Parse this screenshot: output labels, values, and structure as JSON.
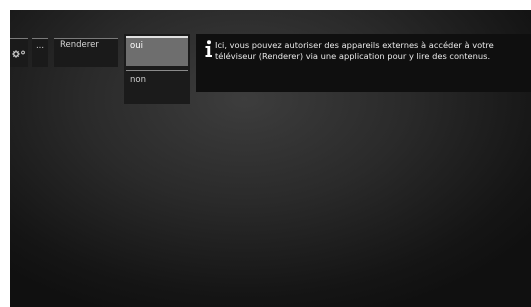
{
  "breadcrumb": {
    "settings_icon": "settings-gear-icon",
    "ellipsis": "...",
    "current": "Renderer"
  },
  "options": {
    "items": [
      {
        "label": "oui",
        "selected": true
      },
      {
        "label": "non",
        "selected": false
      }
    ]
  },
  "info_panel": {
    "icon": "info-icon",
    "text": "Ici, vous pouvez autoriser des appareils externes à accéder à votre téléviseur (Renderer) via une application pour y lire des contenus."
  }
}
